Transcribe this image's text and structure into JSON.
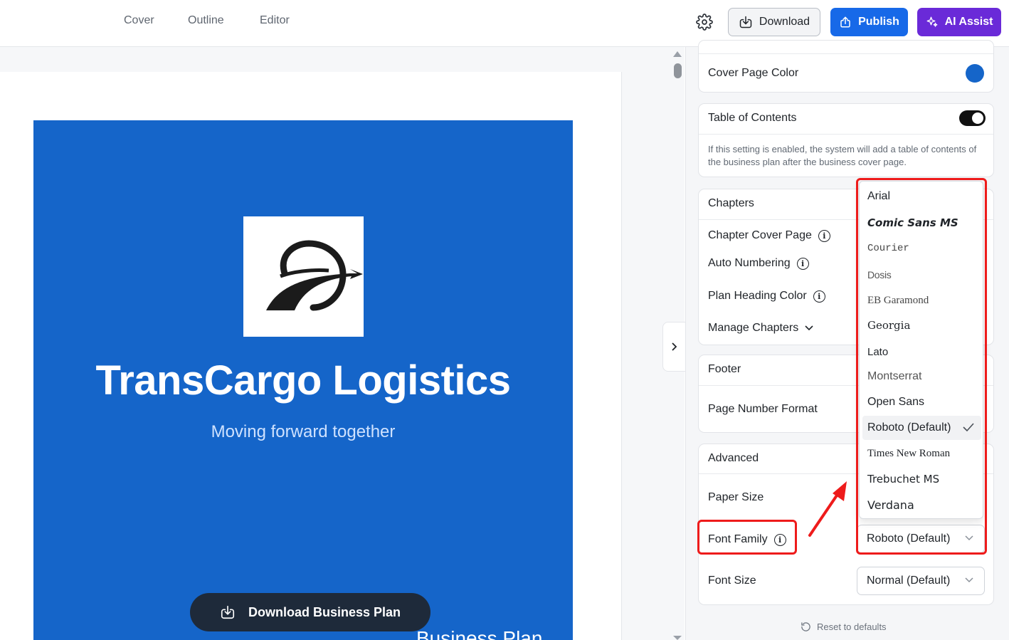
{
  "topbar": {
    "tabs": [
      "Cover",
      "Outline",
      "Editor"
    ],
    "download_label": "Download",
    "publish_label": "Publish",
    "ai_label": "AI Assist"
  },
  "cover": {
    "company_name": "TransCargo Logistics",
    "tagline": "Moving forward together",
    "bottom_text": "Business Plan",
    "background_color": "#1565c9",
    "download_plan_label": "Download Business Plan"
  },
  "settings": {
    "cover_page_color_label": "Cover Page Color",
    "cover_page_color": "#1565c9",
    "toc_label": "Table of Contents",
    "toc_enabled": true,
    "toc_description": "If this setting is enabled, the system will add a table of contents of the business plan after the business cover page.",
    "chapters_title": "Chapters",
    "chapter_cover_page_label": "Chapter Cover Page",
    "auto_numbering_label": "Auto Numbering",
    "plan_heading_color_label": "Plan Heading Color",
    "manage_chapters_label": "Manage Chapters",
    "footer_title": "Footer",
    "page_number_format_label": "Page Number Format",
    "advanced_title": "Advanced",
    "paper_size_label": "Paper Size",
    "font_family_label": "Font Family",
    "font_family_value": "Roboto (Default)",
    "font_size_label": "Font Size",
    "font_size_value": "Normal (Default)",
    "reset_label": "Reset to defaults"
  },
  "font_dropdown": {
    "options": [
      "Arial",
      "Comic Sans MS",
      "Courier",
      "Dosis",
      "EB Garamond",
      "Georgia",
      "Lato",
      "Montserrat",
      "Open Sans",
      "Roboto (Default)",
      "Times New Roman",
      "Trebuchet MS",
      "Verdana"
    ],
    "selected": "Roboto (Default)"
  },
  "annotation_color": "#ee1b1b"
}
